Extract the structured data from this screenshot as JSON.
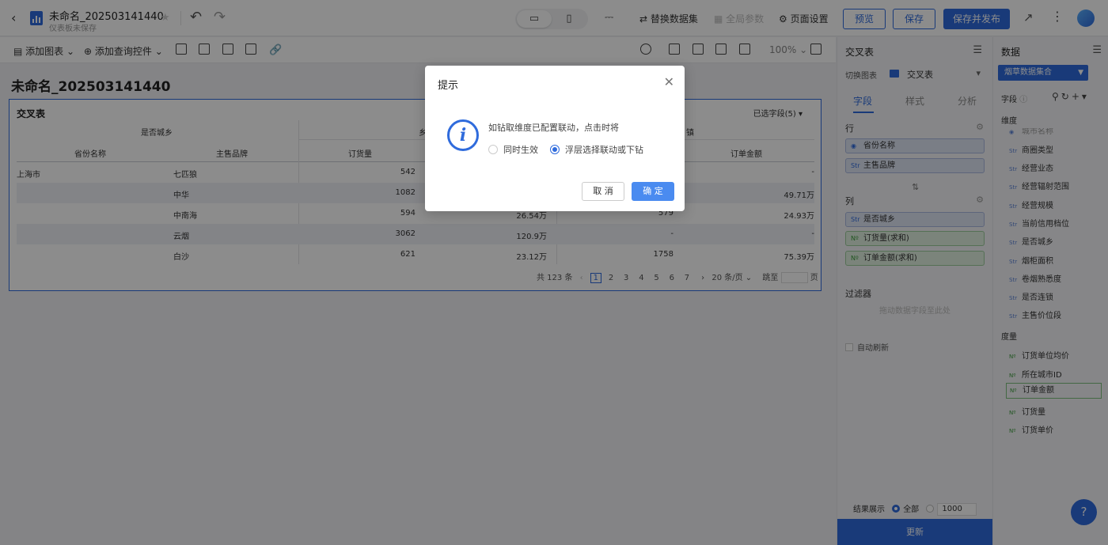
{
  "topbar": {
    "title": "未命名_202503141440",
    "subtitle": "仪表板未保存",
    "replace_dataset": "替换数据集",
    "global_params": "全局参数",
    "page_settings": "页面设置",
    "preview": "预览",
    "save": "保存",
    "save_publish": "保存并发布"
  },
  "toolbar": {
    "add_chart": "添加图表",
    "add_query": "添加查询控件",
    "zoom": "100%"
  },
  "canvas": {
    "dashboard_title": "未命名_202503141440",
    "widget": {
      "title": "交叉表",
      "selected_fields": "已选字段(5)",
      "col_group_header": "是否城乡",
      "col_group_a": "乡",
      "col_group_b": "镇",
      "row_headers": [
        "省份名称",
        "主售品牌"
      ],
      "measure_headers": [
        "订货量",
        "订单金额"
      ],
      "rows": [
        {
          "province": "上海市",
          "brand": "七匹狼",
          "a_qty": "542",
          "a_amt": "",
          "b_qty": "",
          "b_amt": "-"
        },
        {
          "province": "",
          "brand": "中华",
          "a_qty": "1082",
          "a_amt": "",
          "b_qty": "",
          "b_amt": "49.71万"
        },
        {
          "province": "",
          "brand": "中南海",
          "a_qty": "594",
          "a_amt": "26.54万",
          "b_qty": "579",
          "b_amt": "24.93万"
        },
        {
          "province": "",
          "brand": "云烟",
          "a_qty": "3062",
          "a_amt": "120.9万",
          "b_qty": "-",
          "b_amt": "-"
        },
        {
          "province": "",
          "brand": "白沙",
          "a_qty": "621",
          "a_amt": "23.12万",
          "b_qty": "1758",
          "b_amt": "75.39万"
        }
      ],
      "pager": {
        "total": "共 123 条",
        "pages": [
          "1",
          "2",
          "3",
          "4",
          "5",
          "6",
          "7"
        ],
        "page_size": "20 条/页",
        "jump": "跳至",
        "page_unit": "页"
      }
    }
  },
  "properties": {
    "title": "交叉表",
    "switch_chart_label": "切换图表",
    "chart_type": "交叉表",
    "tabs": [
      "字段",
      "样式",
      "分析"
    ],
    "row_label": "行",
    "row_fields": [
      "省份名称",
      "主售品牌"
    ],
    "col_label": "列",
    "col_fields": [
      "是否城乡"
    ],
    "measure_fields": [
      "订货量(求和)",
      "订单金额(求和)"
    ],
    "filter_label": "过滤器",
    "filter_placeholder": "拖动数据字段至此处",
    "auto_refresh": "自动刷新",
    "result_label": "结果展示",
    "result_all": "全部",
    "result_limit": "1000",
    "update": "更新"
  },
  "data_panel": {
    "title": "数据",
    "dataset": "烟草数据集合",
    "fields_label": "字段",
    "dimension_label": "维度",
    "dimensions": [
      "城市名称",
      "商圈类型",
      "经营业态",
      "经营辐射范围",
      "经营规模",
      "当前信用档位",
      "是否城乡",
      "烟柜面积",
      "卷烟熟悉度",
      "是否连锁",
      "主售价位段"
    ],
    "measure_label": "度量",
    "measures": [
      "订货单位均价",
      "所在城市ID",
      "订单金额",
      "订货量",
      "订货单价"
    ]
  },
  "dialog": {
    "title": "提示",
    "message": "如钻取维度已配置联动，点击时将",
    "option_1": "同时生效",
    "option_2": "浮层选择联动或下钻",
    "cancel": "取 消",
    "ok": "确 定"
  },
  "colors": {
    "accent": "#2f6bdc",
    "overlay": "rgba(0,0,0,0.45)"
  }
}
